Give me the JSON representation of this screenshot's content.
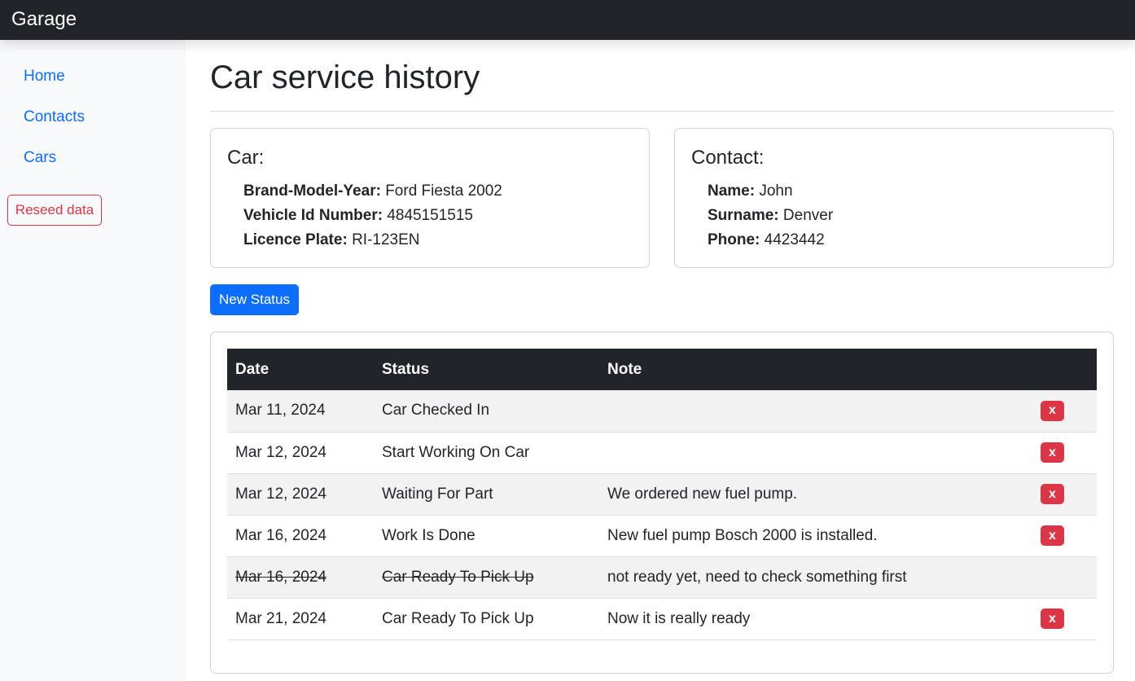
{
  "app": {
    "brand": "Garage"
  },
  "sidebar": {
    "items": [
      {
        "label": "Home"
      },
      {
        "label": "Contacts"
      },
      {
        "label": "Cars"
      }
    ],
    "reseed_label": "Reseed data"
  },
  "main": {
    "title": "Car service history",
    "car": {
      "heading": "Car:",
      "fields": [
        {
          "label": "Brand-Model-Year:",
          "value": "Ford Fiesta 2002"
        },
        {
          "label": "Vehicle Id Number:",
          "value": "4845151515"
        },
        {
          "label": "Licence Plate:",
          "value": "RI-123EN"
        }
      ]
    },
    "contact": {
      "heading": "Contact:",
      "fields": [
        {
          "label": "Name:",
          "value": "John"
        },
        {
          "label": "Surname:",
          "value": "Denver"
        },
        {
          "label": "Phone:",
          "value": "4423442"
        }
      ]
    },
    "new_status_label": "New Status",
    "table": {
      "headers": [
        "Date",
        "Status",
        "Note",
        ""
      ],
      "delete_label": "x",
      "rows": [
        {
          "date": "Mar 11, 2024",
          "status": "Car Checked In",
          "note": "",
          "struck": false,
          "deletable": true
        },
        {
          "date": "Mar 12, 2024",
          "status": "Start Working On Car",
          "note": "",
          "struck": false,
          "deletable": true
        },
        {
          "date": "Mar 12, 2024",
          "status": "Waiting For Part",
          "note": "We ordered new fuel pump.",
          "struck": false,
          "deletable": true
        },
        {
          "date": "Mar 16, 2024",
          "status": "Work Is Done",
          "note": "New fuel pump Bosch 2000 is installed.",
          "struck": false,
          "deletable": true
        },
        {
          "date": "Mar 16, 2024",
          "status": "Car Ready To Pick Up",
          "note": "not ready yet, need to check something first",
          "struck": true,
          "deletable": false
        },
        {
          "date": "Mar 21, 2024",
          "status": "Car Ready To Pick Up",
          "note": "Now it is really ready",
          "struck": false,
          "deletable": true
        }
      ]
    }
  },
  "colors": {
    "topbar": "#212529",
    "link": "#0d6efd",
    "danger": "#dc3545",
    "primary": "#0d6efd"
  }
}
